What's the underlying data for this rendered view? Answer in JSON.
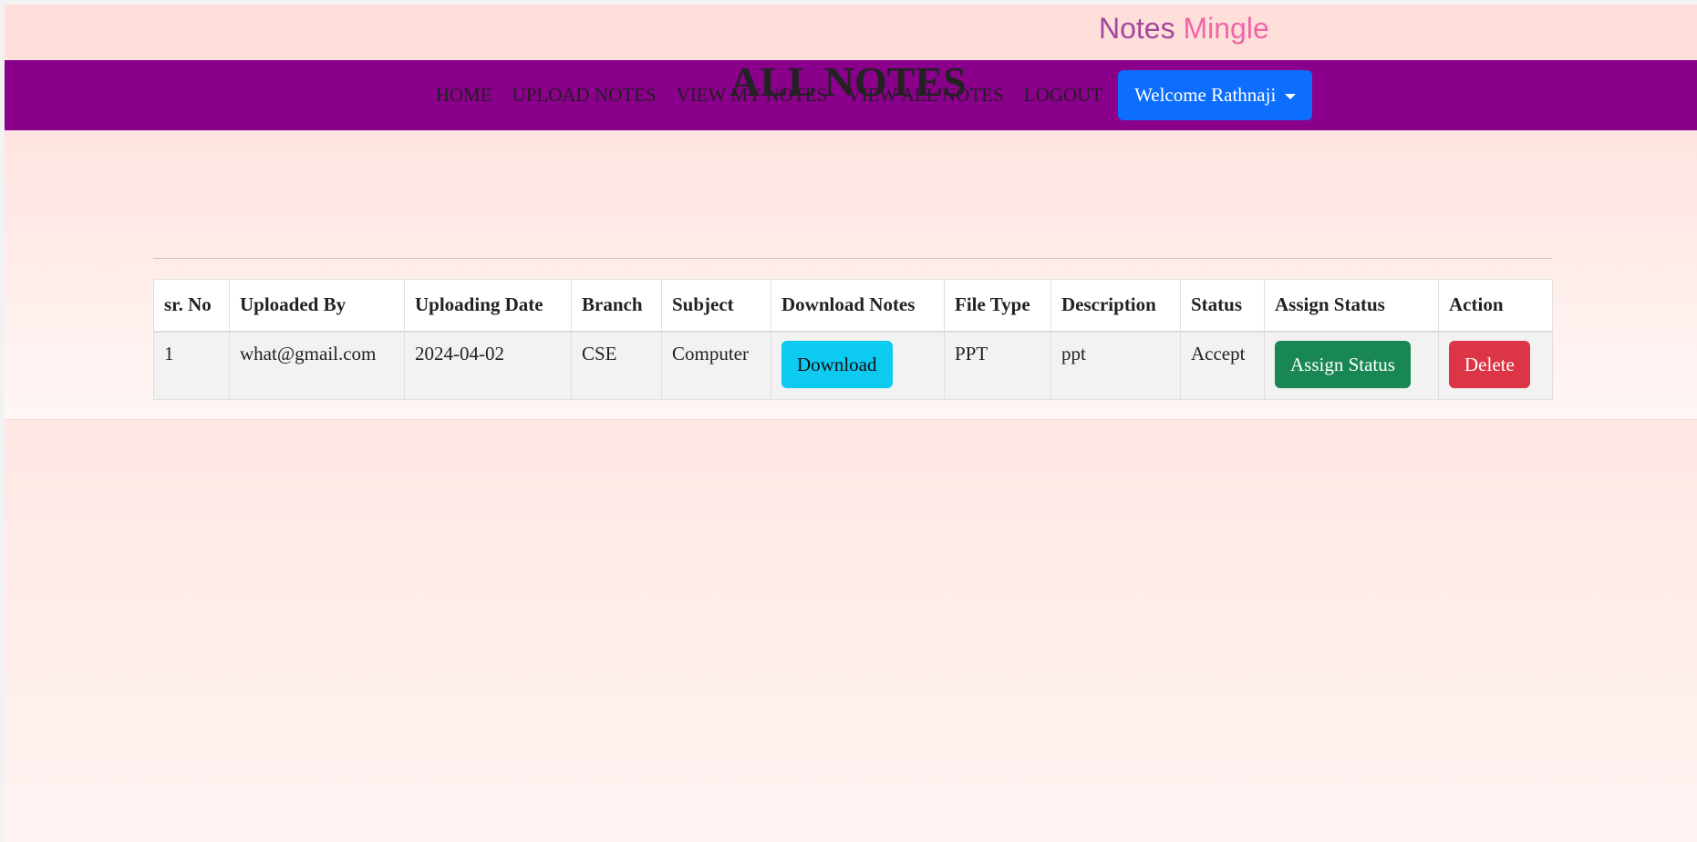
{
  "brand": {
    "part1": "Notes",
    "part2": "Mingle",
    "color1": "#a3479f",
    "color2": "#f066a8"
  },
  "navbar": {
    "background": "#8b008b",
    "links": [
      "HOME",
      "UPLOAD NOTES",
      "VIEW MY NOTES",
      "VIEW ALL NOTES",
      "LOGOUT"
    ],
    "welcome_label": "Welcome Rathnaji",
    "welcome_color": "#0d6efd",
    "welcome_icon": "chevron-down-icon"
  },
  "page": {
    "title": "ALL NOTES"
  },
  "table": {
    "headers": [
      "sr. No",
      "Uploaded By",
      "Uploading Date",
      "Branch",
      "Subject",
      "Download Notes",
      "File Type",
      "Description",
      "Status",
      "Assign Status",
      "Action"
    ],
    "rows": [
      {
        "sr_no": "1",
        "uploaded_by": "what@gmail.com",
        "uploading_date": "2024-04-02",
        "branch": "CSE",
        "subject": "Computer",
        "download_label": "Download",
        "file_type": "PPT",
        "description": "ppt",
        "status": "Accept",
        "assign_label": "Assign Status",
        "delete_label": "Delete"
      }
    ]
  },
  "colors": {
    "download_button": "#0dcaf0",
    "assign_button": "#198754",
    "delete_button": "#dc3545"
  }
}
